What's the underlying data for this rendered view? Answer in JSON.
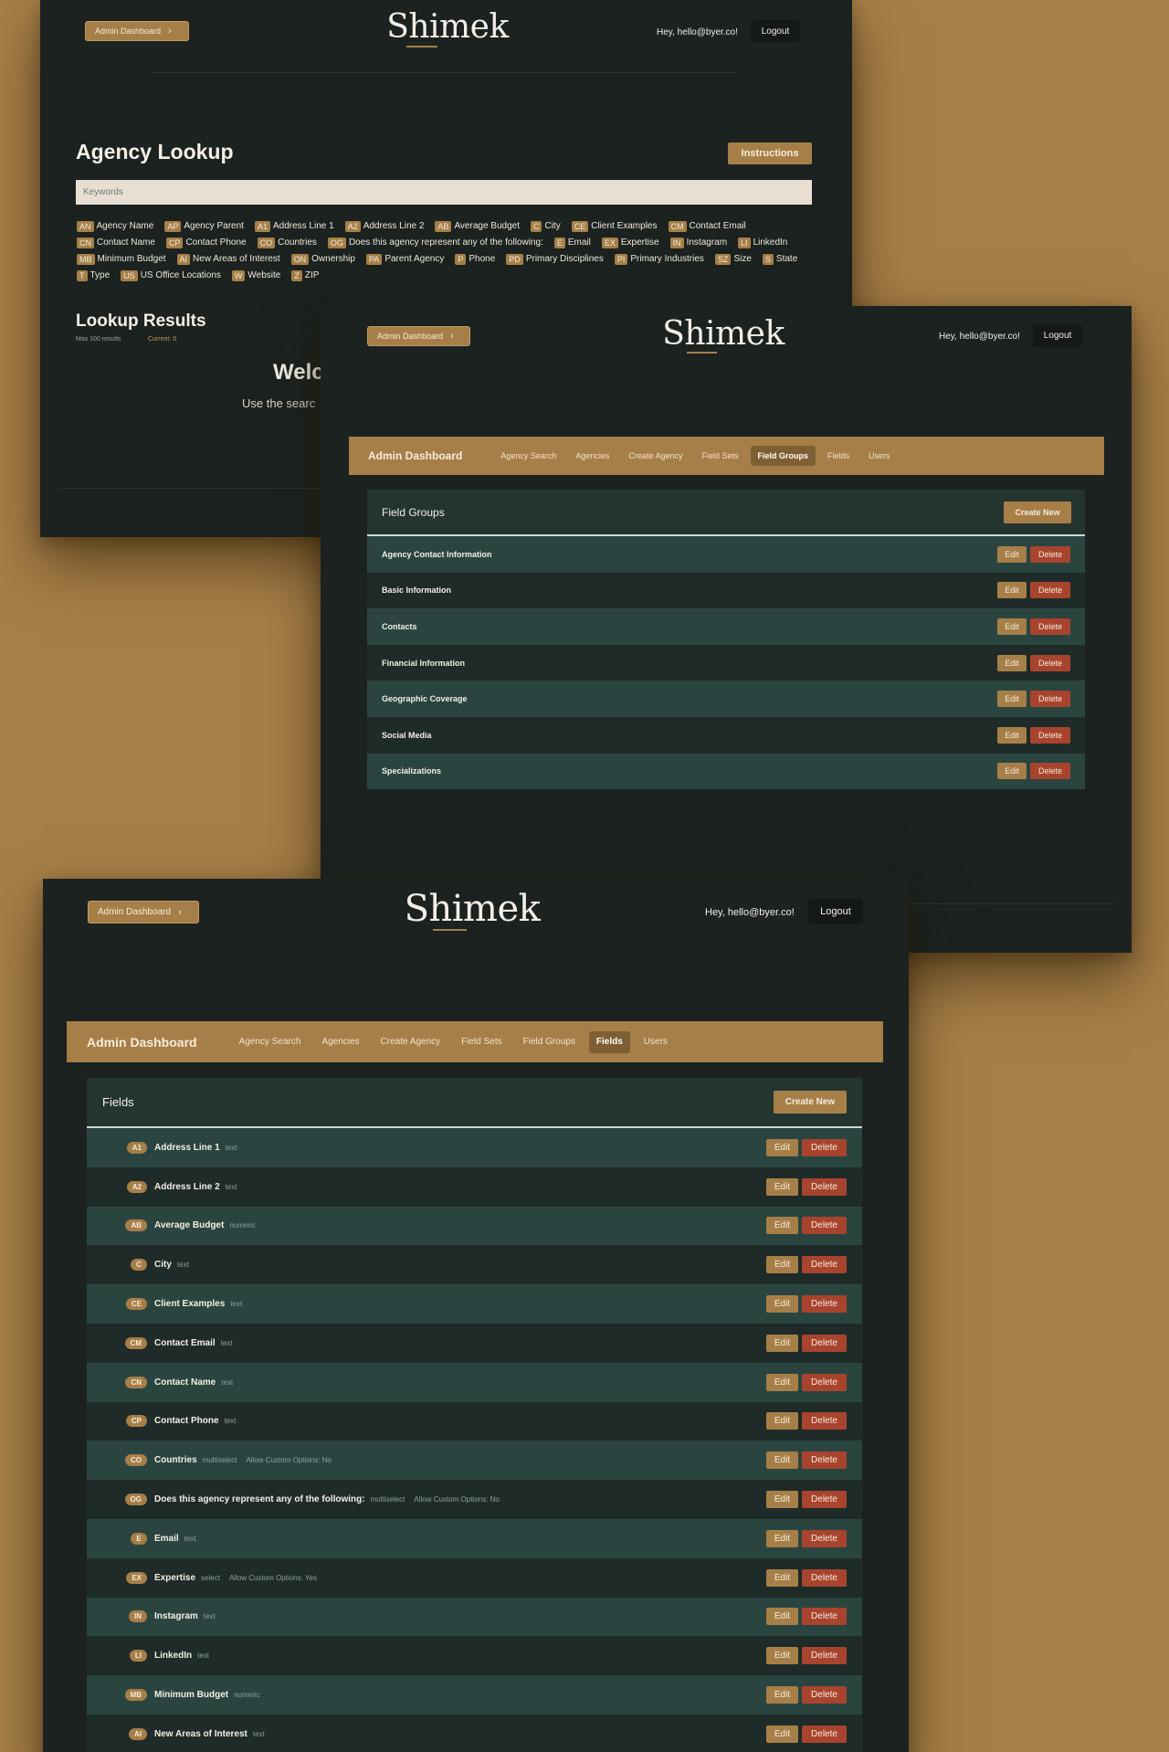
{
  "brand": "Shimek",
  "admin_pill": "Admin Dashboard",
  "greeting": "Hey, hello@byer.co!",
  "logout": "Logout",
  "lookup": {
    "title": "Agency Lookup",
    "instructions": "Instructions",
    "keywords_placeholder": "Keywords",
    "legend": [
      {
        "code": "AN",
        "label": "Agency Name"
      },
      {
        "code": "AP",
        "label": "Agency Parent"
      },
      {
        "code": "A1",
        "label": "Address Line 1"
      },
      {
        "code": "A2",
        "label": "Address Line 2"
      },
      {
        "code": "AB",
        "label": "Average Budget"
      },
      {
        "code": "C",
        "label": "City"
      },
      {
        "code": "CE",
        "label": "Client Examples"
      },
      {
        "code": "CM",
        "label": "Contact Email"
      },
      {
        "code": "CN",
        "label": "Contact Name"
      },
      {
        "code": "CP",
        "label": "Contact Phone"
      },
      {
        "code": "CO",
        "label": "Countries"
      },
      {
        "code": "OG",
        "label": "Does this agency represent any of the following:"
      },
      {
        "code": "E",
        "label": "Email"
      },
      {
        "code": "EX",
        "label": "Expertise"
      },
      {
        "code": "IN",
        "label": "Instagram"
      },
      {
        "code": "LI",
        "label": "LinkedIn"
      },
      {
        "code": "MB",
        "label": "Minimum Budget"
      },
      {
        "code": "AI",
        "label": "New Areas of Interest"
      },
      {
        "code": "ON",
        "label": "Ownership"
      },
      {
        "code": "PA",
        "label": "Parent Agency"
      },
      {
        "code": "P",
        "label": "Phone"
      },
      {
        "code": "PD",
        "label": "Primary Disciplines"
      },
      {
        "code": "PI",
        "label": "Primary Industries"
      },
      {
        "code": "SZ",
        "label": "Size"
      },
      {
        "code": "S",
        "label": "State"
      },
      {
        "code": "T",
        "label": "Type"
      },
      {
        "code": "US",
        "label": "US Office Locations"
      },
      {
        "code": "W",
        "label": "Website"
      },
      {
        "code": "Z",
        "label": "ZIP"
      }
    ],
    "results_title": "Lookup Results",
    "max_results": "Max 100 results",
    "current": "Current: 0",
    "welcome": "Welc",
    "welcome_sub": "Use the searc"
  },
  "admin_nav": {
    "title": "Admin Dashboard",
    "tabs": [
      "Agency Search",
      "Agencies",
      "Create Agency",
      "Field Sets",
      "Field Groups",
      "Fields",
      "Users"
    ]
  },
  "field_groups": {
    "title": "Field Groups",
    "create": "Create New",
    "edit": "Edit",
    "delete": "Delete",
    "active_tab": "Field Groups",
    "rows": [
      "Agency Contact Information",
      "Basic Information",
      "Contacts",
      "Financial Information",
      "Geographic Coverage",
      "Social Media",
      "Specializations"
    ]
  },
  "fields": {
    "title": "Fields",
    "create": "Create New",
    "edit": "Edit",
    "delete": "Delete",
    "active_tab": "Fields",
    "rows": [
      {
        "code": "A1",
        "name": "Address Line 1",
        "type": "text",
        "opts": ""
      },
      {
        "code": "A2",
        "name": "Address Line 2",
        "type": "text",
        "opts": ""
      },
      {
        "code": "AB",
        "name": "Average Budget",
        "type": "numeric",
        "opts": ""
      },
      {
        "code": "C",
        "name": "City",
        "type": "text",
        "opts": ""
      },
      {
        "code": "CE",
        "name": "Client Examples",
        "type": "text",
        "opts": ""
      },
      {
        "code": "CM",
        "name": "Contact Email",
        "type": "text",
        "opts": ""
      },
      {
        "code": "CN",
        "name": "Contact Name",
        "type": "text",
        "opts": ""
      },
      {
        "code": "CP",
        "name": "Contact Phone",
        "type": "text",
        "opts": ""
      },
      {
        "code": "CO",
        "name": "Countries",
        "type": "multiselect",
        "opts": "Allow Custom Options: No"
      },
      {
        "code": "OG",
        "name": "Does this agency represent any of the following:",
        "type": "multiselect",
        "opts": "Allow Custom Options: No"
      },
      {
        "code": "E",
        "name": "Email",
        "type": "text",
        "opts": ""
      },
      {
        "code": "EX",
        "name": "Expertise",
        "type": "select",
        "opts": "Allow Custom Options: Yes"
      },
      {
        "code": "IN",
        "name": "Instagram",
        "type": "text",
        "opts": ""
      },
      {
        "code": "LI",
        "name": "LinkedIn",
        "type": "text",
        "opts": ""
      },
      {
        "code": "MB",
        "name": "Minimum Budget",
        "type": "numeric",
        "opts": ""
      },
      {
        "code": "AI",
        "name": "New Areas of Interest",
        "type": "text",
        "opts": ""
      }
    ]
  },
  "colors": {
    "background": "#a67f48",
    "window": "#1b2220",
    "accent": "#a67f48",
    "delete": "#a8442e",
    "row_light": "#2a4540",
    "row_dark": "#1f2b28"
  }
}
